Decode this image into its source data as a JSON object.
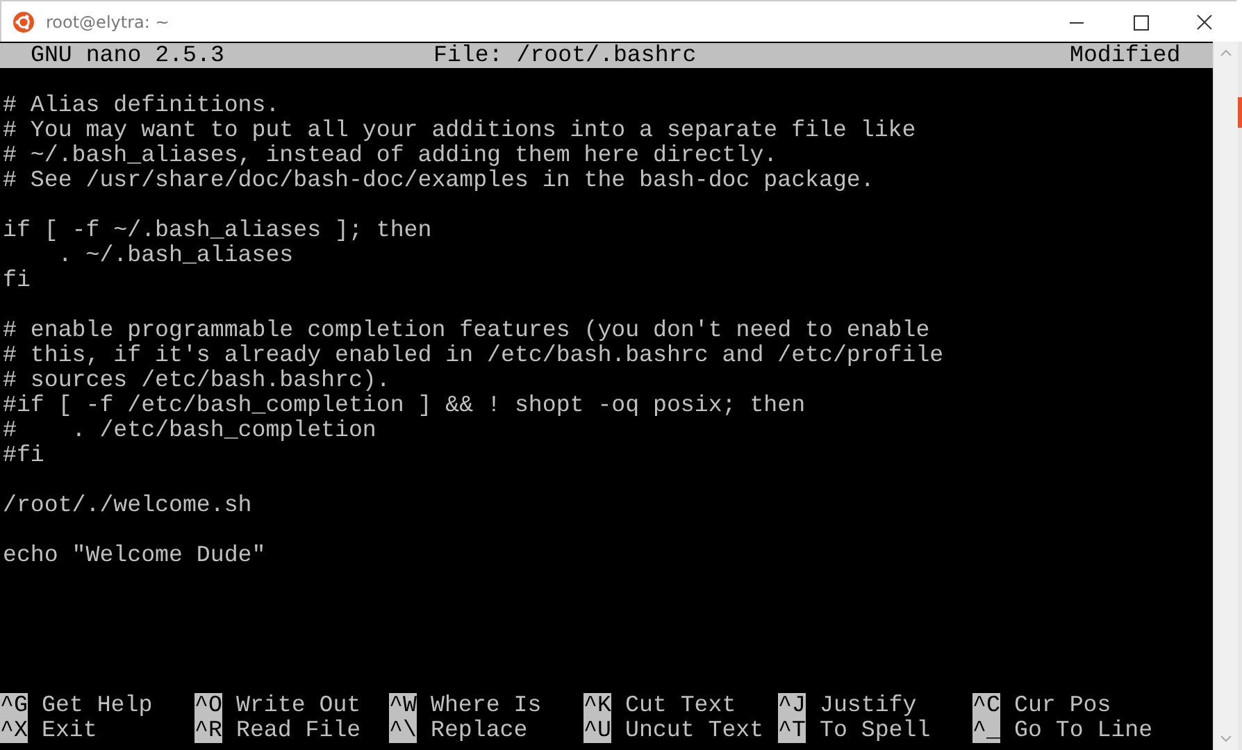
{
  "window": {
    "title": "root@elytra: ~"
  },
  "nano_header": {
    "version": "GNU nano 2.5.3",
    "file": "File: /root/.bashrc",
    "status": "Modified"
  },
  "editor_blocks": [
    [
      "# Alias definitions.",
      "# You may want to put all your additions into a separate file like",
      "# ~/.bash_aliases, instead of adding them here directly.",
      "# See /usr/share/doc/bash-doc/examples in the bash-doc package."
    ],
    [
      "if [ -f ~/.bash_aliases ]; then",
      "    . ~/.bash_aliases",
      "fi"
    ],
    [
      "# enable programmable completion features (you don't need to enable",
      "# this, if it's already enabled in /etc/bash.bashrc and /etc/profile",
      "# sources /etc/bash.bashrc).",
      "#if [ -f /etc/bash_completion ] && ! shopt -oq posix; then",
      "#    . /etc/bash_completion",
      "#fi"
    ],
    [
      "/root/./welcome.sh"
    ],
    [
      "echo \"Welcome Dude\""
    ]
  ],
  "shortcuts": [
    [
      {
        "key": "^G",
        "label": "Get Help"
      },
      {
        "key": "^O",
        "label": "Write Out"
      },
      {
        "key": "^W",
        "label": "Where Is"
      },
      {
        "key": "^K",
        "label": "Cut Text"
      },
      {
        "key": "^J",
        "label": "Justify"
      },
      {
        "key": "^C",
        "label": "Cur Pos"
      }
    ],
    [
      {
        "key": "^X",
        "label": "Exit"
      },
      {
        "key": "^R",
        "label": "Read File"
      },
      {
        "key": "^\\",
        "label": "Replace"
      },
      {
        "key": "^U",
        "label": "Uncut Text"
      },
      {
        "key": "^T",
        "label": "To Spell"
      },
      {
        "key": "^_",
        "label": "Go To Line"
      }
    ]
  ]
}
